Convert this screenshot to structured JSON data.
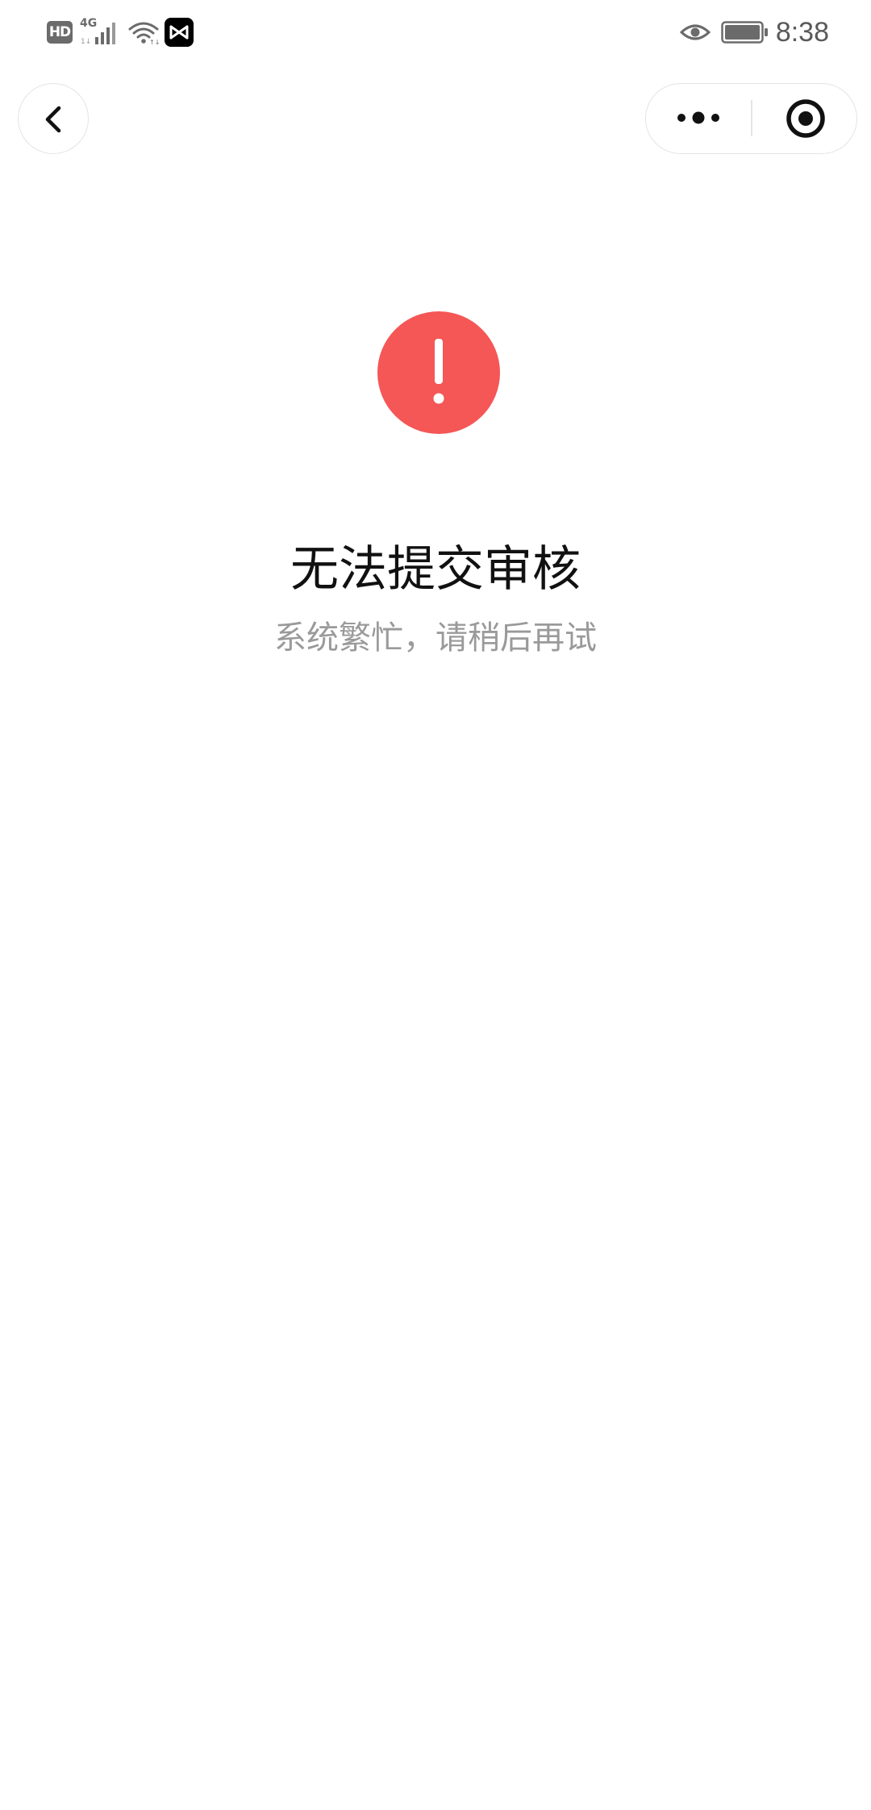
{
  "status_bar": {
    "hd_badge": "HD",
    "network_type": "4G",
    "time": "8:38",
    "icons": [
      "hd-icon",
      "signal-icon",
      "wifi-icon",
      "app-icon",
      "eye-icon",
      "battery-icon"
    ]
  },
  "nav": {
    "back_icon": "chevron-left-icon",
    "more_icon": "more-dots-icon",
    "close_icon": "target-circle-icon"
  },
  "content": {
    "error_icon": "exclamation-circle-icon",
    "error_color": "#f55656",
    "title": "无法提交审核",
    "subtitle": "系统繁忙，请稍后再试"
  }
}
